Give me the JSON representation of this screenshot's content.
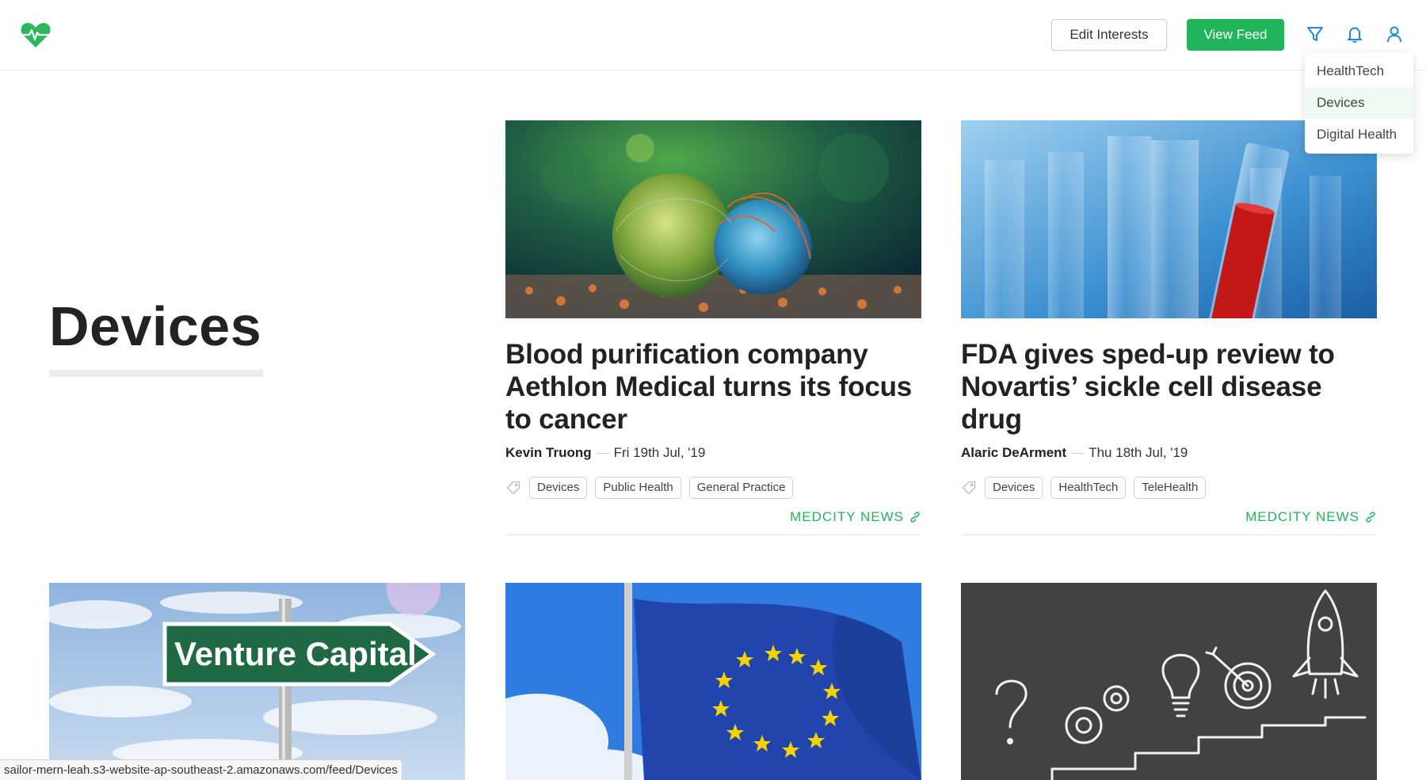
{
  "header": {
    "logo_icon": "heart-pulse-icon",
    "edit_interests_label": "Edit Interests",
    "view_feed_label": "View Feed",
    "accent_color": "#22b45a",
    "icons": [
      "filter-icon",
      "bell-icon",
      "user-icon"
    ]
  },
  "dropdown": {
    "items": [
      {
        "label": "HealthTech",
        "active": false
      },
      {
        "label": "Devices",
        "active": true
      },
      {
        "label": "Digital Health",
        "active": false
      }
    ]
  },
  "section": {
    "title": "Devices"
  },
  "cards": [
    {
      "image": "virus-cells-illustration",
      "title": "Blood purification company Aethlon Medical turns its focus to cancer",
      "author": "Kevin Truong",
      "date": "Fri 19th Jul, '19",
      "tags": [
        "Devices",
        "Public Health",
        "General Practice"
      ],
      "source": "MEDCITY NEWS"
    },
    {
      "image": "test-tubes-photo",
      "title": "FDA gives sped-up review to Novartis’ sickle cell disease drug",
      "author": "Alaric DeArment",
      "date": "Thu 18th Jul, '19",
      "tags": [
        "Devices",
        "HealthTech",
        "TeleHealth"
      ],
      "source": "MEDCITY NEWS"
    }
  ],
  "row2": [
    {
      "image": "venture-capital-sign",
      "sign_text": "Venture Capital"
    },
    {
      "image": "eu-flag-photo"
    },
    {
      "image": "chalkboard-rocket-drawing"
    }
  ],
  "statusbar": {
    "url": "sailor-mern-leah.s3-website-ap-southeast-2.amazonaws.com/feed/Devices"
  }
}
